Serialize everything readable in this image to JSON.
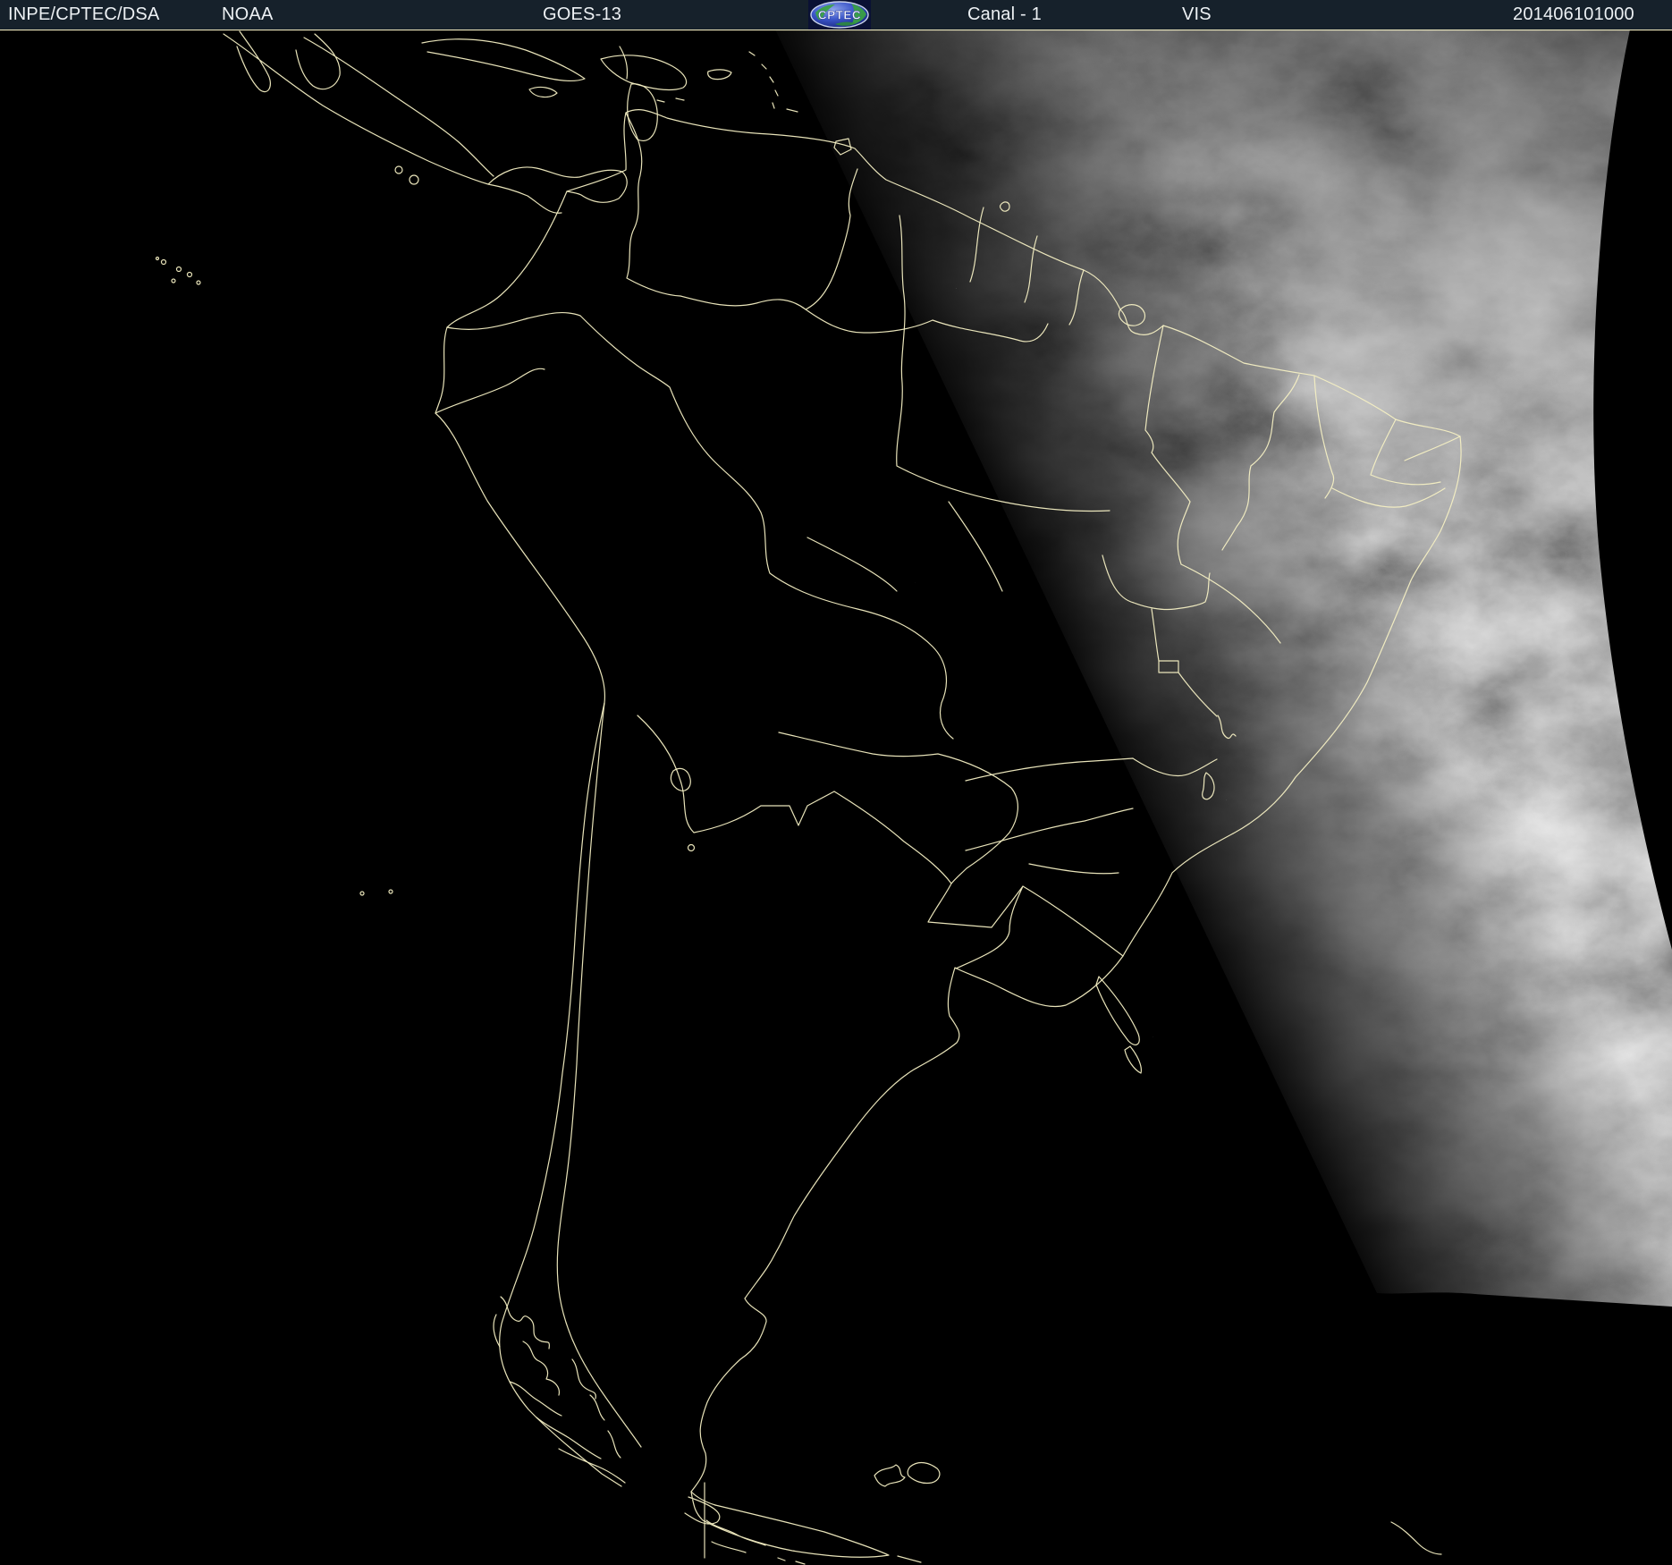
{
  "header": {
    "agency": "INPE/CPTEC/DSA",
    "organization": "NOAA",
    "satellite": "GOES-13",
    "channel": "Canal - 1",
    "channel_type": "VIS",
    "timestamp": "201406101000",
    "logo_text": "CPTEC"
  },
  "colors": {
    "header_bg": "#16212b",
    "header_text": "#edf1f4",
    "map_outline": "#f4efc3",
    "night": "#000000",
    "logo_blue": "#2a42b4",
    "logo_blue_light": "#7b96e6",
    "logo_green": "#3aa43e",
    "logo_text_color": "#f2f4ff"
  }
}
